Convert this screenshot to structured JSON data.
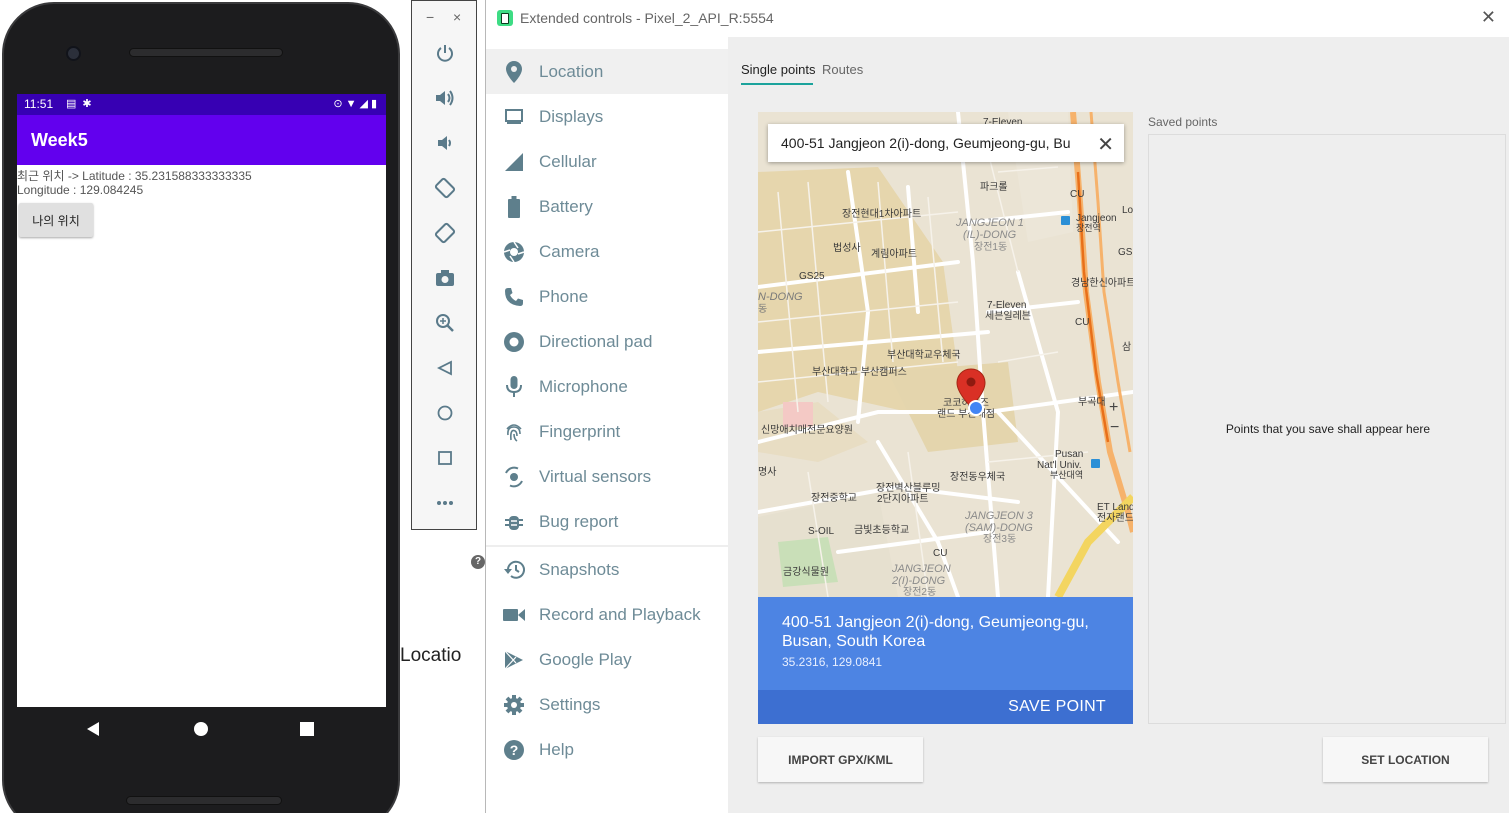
{
  "phone": {
    "status_time": "11:51",
    "app_title": "Week5",
    "latitude_line": "최근 위치 -> Latitude : 35.231588333333335",
    "longitude_line": "Longitude : 129.084245",
    "my_location_button": "나의 위치"
  },
  "toolbar": {
    "minimize": "−",
    "close": "×"
  },
  "background": {
    "location_text": "Locatio"
  },
  "ext": {
    "title": "Extended controls - Pixel_2_API_R:5554",
    "sidebar": [
      {
        "label": "Location",
        "icon": "location-pin-icon"
      },
      {
        "label": "Displays",
        "icon": "display-icon"
      },
      {
        "label": "Cellular",
        "icon": "cellular-icon"
      },
      {
        "label": "Battery",
        "icon": "battery-icon"
      },
      {
        "label": "Camera",
        "icon": "camera-icon"
      },
      {
        "label": "Phone",
        "icon": "phone-icon"
      },
      {
        "label": "Directional pad",
        "icon": "dpad-icon"
      },
      {
        "label": "Microphone",
        "icon": "microphone-icon"
      },
      {
        "label": "Fingerprint",
        "icon": "fingerprint-icon"
      },
      {
        "label": "Virtual sensors",
        "icon": "sensors-icon"
      },
      {
        "label": "Bug report",
        "icon": "bug-icon"
      },
      {
        "label": "Snapshots",
        "icon": "history-icon"
      },
      {
        "label": "Record and Playback",
        "icon": "video-icon"
      },
      {
        "label": "Google Play",
        "icon": "play-icon"
      },
      {
        "label": "Settings",
        "icon": "gear-icon"
      },
      {
        "label": "Help",
        "icon": "help-icon"
      }
    ],
    "tabs": {
      "single": "Single points",
      "routes": "Routes"
    },
    "map": {
      "search_value": "400-51 Jangjeon 2(i)-dong, Geumjeong-gu, Bu",
      "labels": {
        "seven_eleven_top": "7-Eleven",
        "cu_top": "CU",
        "paris": "파크롤",
        "apt1": "장전현대1차아파트",
        "jangjeon1_en": "JANGJEON 1",
        "jangjeon1_en2": "(IL)-DONG",
        "jangjeon1_ko": "장전1동",
        "jangjeon_station": "Jangjeon",
        "jangjeon_station_ko": "장전역",
        "beopseongsa": "법성사",
        "gyerim": "계림아파트",
        "gs25_left": "GS25",
        "gs_right": "GS",
        "ndong": "N-DONG",
        "dong_char": "동",
        "gyeongnam": "경남한신아파트",
        "seven_eleven_mid": "7-Eleven",
        "seven_eleven_mid_ko": "세븐일레븐",
        "cu_mid": "CU",
        "pnu_post": "부산대학교우체국",
        "pnu_campus": "부산대학교 부산캠퍼스",
        "sam": "삼",
        "lo": "Lo",
        "koko": "코코하우즈",
        "koko2": "랜드 부산대점",
        "hospital": "신망애치매전문요양원",
        "bukuk": "부곡대",
        "myeongsa": "명사",
        "post_office": "장전동우체국",
        "pusan_univ": "Pusan",
        "pusan_univ2": "Nat'l Univ.",
        "pusan_univ_ko": "부산대역",
        "byeoksan": "장전벽산블루밍",
        "byeoksan2": "2단지아파트",
        "middle_school": "장전중학교",
        "etland": "ET Land",
        "etland_ko": "전자랜드",
        "soil": "S-OIL",
        "geumbit": "금빛초등학교",
        "jangjeon3_en": "JANGJEON 3",
        "jangjeon3_en2": "(SAM)-DONG",
        "jangjeon3_ko": "장전3동",
        "cu_bottom": "CU",
        "botanical": "금강식물원",
        "jangjeon2_en": "JANGJEON",
        "jangjeon2_en2": "2(I)-DONG",
        "jangjeon2_ko": "장전2동",
        "zoom_in": "+",
        "zoom_out": "−"
      }
    },
    "place": {
      "name": "400-51 Jangjeon 2(i)-dong, Geumjeong-gu, Busan, South Korea",
      "coords": "35.2316, 129.0841",
      "save_label": "SAVE POINT"
    },
    "saved": {
      "label": "Saved points",
      "empty_text": "Points that you save shall appear here"
    },
    "buttons": {
      "import": "IMPORT GPX/KML",
      "set_location": "SET LOCATION"
    }
  },
  "colors": {
    "status_bar": "#3700b3",
    "app_bar": "#6200ee",
    "tab_accent": "#1ba39c",
    "place_card": "#4d84e3",
    "save_bar": "#3d6fd1",
    "sidebar_text": "#6e8b97"
  }
}
